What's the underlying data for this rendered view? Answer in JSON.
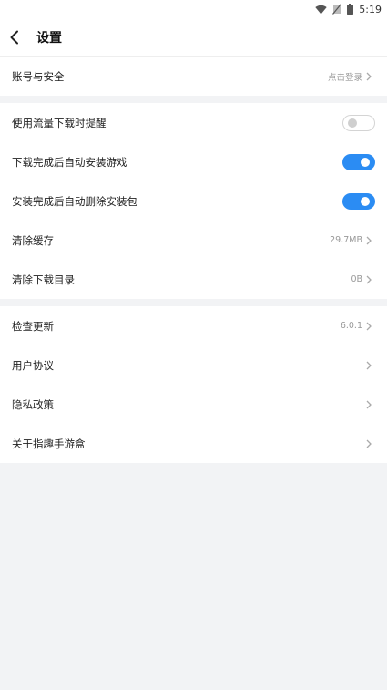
{
  "status_bar": {
    "time": "5:19",
    "icons": [
      "wifi-icon",
      "no-sim-icon",
      "battery-icon"
    ]
  },
  "header": {
    "title": "设置",
    "back_icon": "chevron-left-icon"
  },
  "account": {
    "label": "账号与安全",
    "value": "点击登录"
  },
  "settings": {
    "data_warning": {
      "label": "使用流量下载时提醒",
      "enabled": false
    },
    "auto_install": {
      "label": "下载完成后自动安装游戏",
      "enabled": true
    },
    "auto_delete": {
      "label": "安装完成后自动删除安装包",
      "enabled": true
    },
    "clear_cache": {
      "label": "清除缓存",
      "value": "29.7MB"
    },
    "clear_downloads": {
      "label": "清除下载目录",
      "value": "0B"
    }
  },
  "about": {
    "check_update": {
      "label": "检查更新",
      "value": "6.0.1"
    },
    "user_agreement": {
      "label": "用户协议"
    },
    "privacy_policy": {
      "label": "隐私政策"
    },
    "about_app": {
      "label": "关于指趣手游盒"
    }
  },
  "colors": {
    "accent": "#2b8cf3",
    "background": "#f2f3f5",
    "toggle_off_border": "#d4d4d4"
  }
}
